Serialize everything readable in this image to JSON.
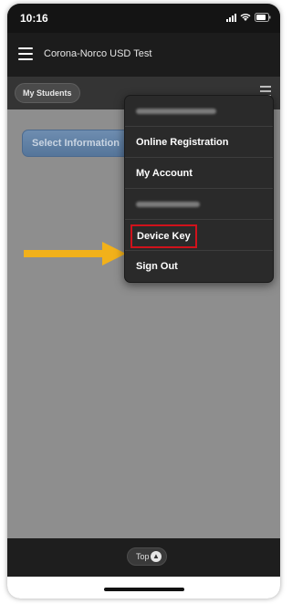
{
  "status_bar": {
    "time": "10:16"
  },
  "app_bar": {
    "title": "Corona-Norco USD Test"
  },
  "toolbar": {
    "my_students_label": "My Students"
  },
  "content": {
    "select_button_label": "Select Information"
  },
  "menu": {
    "items": [
      {
        "label": "",
        "redacted": true
      },
      {
        "label": "Online Registration"
      },
      {
        "label": "My Account"
      },
      {
        "label": "",
        "redacted": true
      },
      {
        "label": "Device Key",
        "highlighted": true
      },
      {
        "label": "Sign Out"
      }
    ]
  },
  "bottom_bar": {
    "top_label": "Top"
  },
  "colors": {
    "highlight_border": "#d0121b",
    "arrow": "#f2b11a",
    "select_button": "#5f7fa6"
  }
}
